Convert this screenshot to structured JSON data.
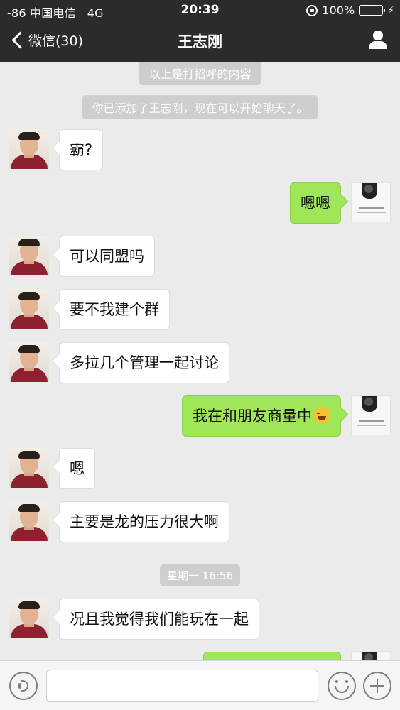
{
  "status_bar": {
    "carrier": "-86 中国电信",
    "network": "4G",
    "time": "20:39",
    "battery": "100%",
    "battery_level": 1.0
  },
  "nav": {
    "back_label": "微信(30)",
    "title": "王志刚"
  },
  "notices": {
    "greeting": "以上是打招呼的内容",
    "added": "你已添加了王志刚，现在可以开始聊天了。"
  },
  "messages": [
    {
      "sender": "friend",
      "text": "霸?"
    },
    {
      "sender": "me",
      "text": "嗯嗯"
    },
    {
      "sender": "friend",
      "text": "可以同盟吗"
    },
    {
      "sender": "friend",
      "text": "要不我建个群"
    },
    {
      "sender": "friend",
      "text": "多拉几个管理一起讨论"
    },
    {
      "sender": "me",
      "text": "我在和朋友商量中",
      "emoji": "laughing-tears-emoji"
    },
    {
      "sender": "friend",
      "text": "嗯"
    },
    {
      "sender": "friend",
      "text": "主要是龙的压力很大啊"
    },
    {
      "sender": "friend",
      "text": "况且我觉得我们能玩在一起"
    }
  ],
  "timestamp": "星期一 16:56",
  "input": {
    "value": "",
    "placeholder": ""
  },
  "colors": {
    "nav_background": "#2b2b2f",
    "chat_background": "#ebebeb",
    "my_bubble": "#9fe658",
    "friend_bubble": "#ffffff",
    "battery_fill": "#4cd964"
  }
}
